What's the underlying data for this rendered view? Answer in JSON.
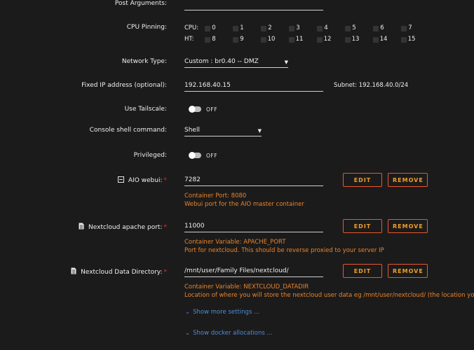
{
  "post_arguments": {
    "label": "Post Arguments:",
    "value": ""
  },
  "cpu_pinning": {
    "label": "CPU Pinning:",
    "cpu_label": "CPU:",
    "ht_label": "HT:",
    "cpu": [
      "0",
      "1",
      "2",
      "3",
      "4",
      "5",
      "6",
      "7"
    ],
    "ht": [
      "8",
      "9",
      "10",
      "11",
      "12",
      "13",
      "14",
      "15"
    ]
  },
  "network_type": {
    "label": "Network Type:",
    "value": "Custom : br0.40 -- DMZ"
  },
  "fixed_ip": {
    "label": "Fixed IP address (optional):",
    "value": "192.168.40.15",
    "subnet": "Subnet: 192.168.40.0/24"
  },
  "tailscale": {
    "label": "Use Tailscale:",
    "state": "OFF"
  },
  "console_shell": {
    "label": "Console shell command:",
    "value": "Shell"
  },
  "privileged": {
    "label": "Privileged:",
    "state": "OFF"
  },
  "aio_webui": {
    "label": "AIO webui:",
    "value": "7282",
    "note1": "Container Port: 8080",
    "note2": "Webui port for the AIO master container"
  },
  "apache_port": {
    "label": "Nextcloud apache port:",
    "value": "11000",
    "note1": "Container Variable: APACHE_PORT",
    "note2": "Port for nextcloud. This should be reverse proxied to your server IP"
  },
  "data_dir": {
    "label": "Nextcloud Data Directory:",
    "value": "/mnt/user/Family Files/nextcloud/",
    "note1": "Container Variable: NEXTCLOUD_DATADIR",
    "note2": "Location of where you will store the nextcloud user data eg /mnt/user/nextcloud/ (the location you choose"
  },
  "required_marker": "*",
  "buttons": {
    "edit": "EDIT",
    "remove": "REMOVE"
  },
  "links": {
    "more_settings": "Show more settings ...",
    "docker_allocations": "Show docker allocations ..."
  },
  "colors": {
    "background": "#1c1b1b",
    "accent_orange": "#e9842b",
    "button_border": "#e8572b",
    "link_blue": "#4c8ddb",
    "required_red": "#e5322b"
  }
}
